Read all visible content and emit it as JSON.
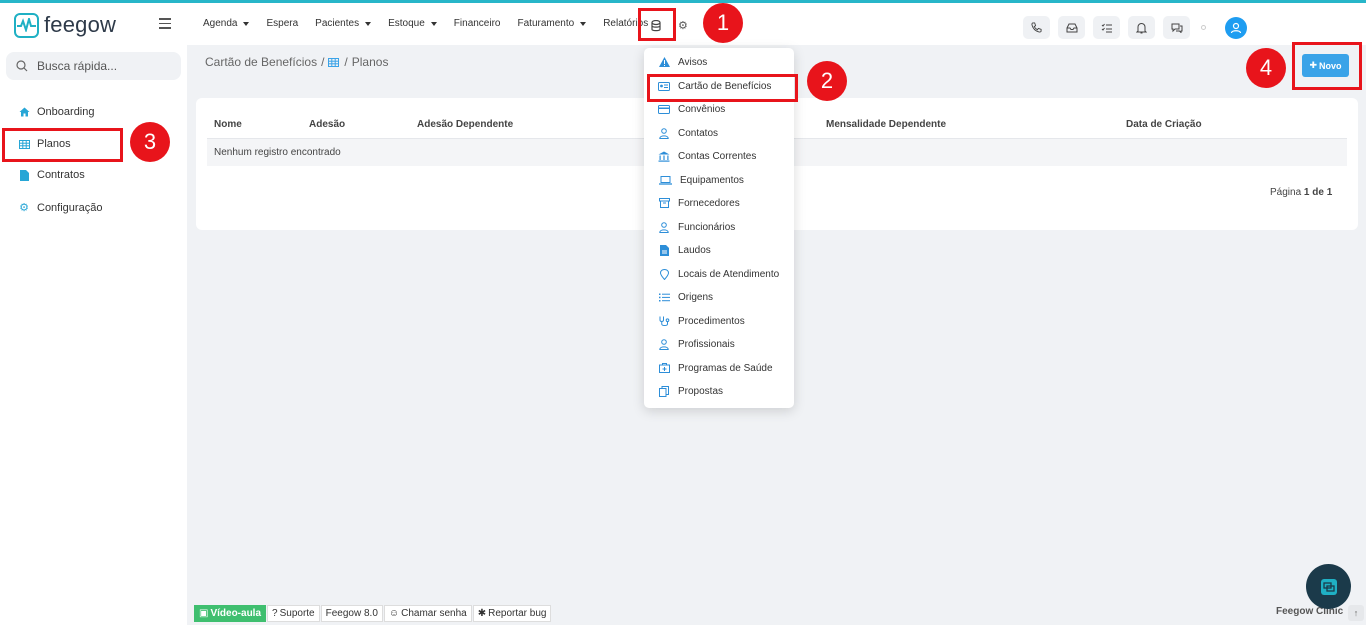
{
  "app": {
    "logo_text": "feegow",
    "brand_color": "#1fb0c4",
    "accent_color": "#3aa3e8",
    "annotation_color": "#e8141b"
  },
  "nav": {
    "items": [
      {
        "label": "Agenda",
        "caret": true
      },
      {
        "label": "Espera",
        "caret": false
      },
      {
        "label": "Pacientes",
        "caret": true
      },
      {
        "label": "Estoque",
        "caret": true
      },
      {
        "label": "Financeiro",
        "caret": false
      },
      {
        "label": "Faturamento",
        "caret": true
      },
      {
        "label": "Relatórios",
        "caret": false
      }
    ],
    "icons": [
      "database-icon",
      "gear-icon"
    ],
    "right_icons": [
      "phone-icon",
      "inbox-icon",
      "checklist-icon",
      "bell-icon",
      "chat-icon",
      "user-avatar-icon"
    ]
  },
  "sidebar": {
    "search_placeholder": "Busca rápida...",
    "items": [
      {
        "label": "Onboarding",
        "icon": "home-icon"
      },
      {
        "label": "Planos",
        "icon": "grid-table-icon"
      },
      {
        "label": "Contratos",
        "icon": "document-icon"
      },
      {
        "label": "Configuração",
        "icon": "gear-icon"
      }
    ]
  },
  "breadcrumb": {
    "parent": "Cartão de Benefícios",
    "separator": "/",
    "current": "Planos"
  },
  "toolbar": {
    "new_label": "Novo"
  },
  "table": {
    "columns": [
      "Nome",
      "Adesão",
      "Adesão Dependente",
      "Mensalidade Dependente",
      "Data de Criação"
    ],
    "empty_message": "Nenhum registro encontrado",
    "pagination": {
      "prefix": "Página",
      "current": "1",
      "of_label": "de",
      "total": "1"
    }
  },
  "dropdown": {
    "items": [
      {
        "label": "Avisos",
        "icon": "warning-icon"
      },
      {
        "label": "Cartão de Benefícios",
        "icon": "id-card-icon"
      },
      {
        "label": "Convênios",
        "icon": "card-icon"
      },
      {
        "label": "Contatos",
        "icon": "person-icon"
      },
      {
        "label": "Contas Correntes",
        "icon": "bank-icon"
      },
      {
        "label": "Equipamentos",
        "icon": "laptop-icon"
      },
      {
        "label": "Fornecedores",
        "icon": "archive-icon"
      },
      {
        "label": "Funcionários",
        "icon": "person-icon"
      },
      {
        "label": "Laudos",
        "icon": "file-icon"
      },
      {
        "label": "Locais de Atendimento",
        "icon": "location-pin-icon"
      },
      {
        "label": "Origens",
        "icon": "list-icon"
      },
      {
        "label": "Procedimentos",
        "icon": "stethoscope-icon"
      },
      {
        "label": "Profissionais",
        "icon": "person-icon"
      },
      {
        "label": "Programas de Saúde",
        "icon": "medical-box-icon"
      },
      {
        "label": "Propostas",
        "icon": "copy-icon"
      }
    ]
  },
  "annotations": {
    "badges": [
      "1",
      "2",
      "3",
      "4"
    ]
  },
  "footer": {
    "video_label": "Vídeo-aula",
    "support_label": "Suporte",
    "version_label": "Feegow 8.0",
    "call_label": "Chamar senha",
    "bug_label": "Reportar bug",
    "clinic_label": "Feegow Clinic",
    "up_arrow": "↑"
  }
}
